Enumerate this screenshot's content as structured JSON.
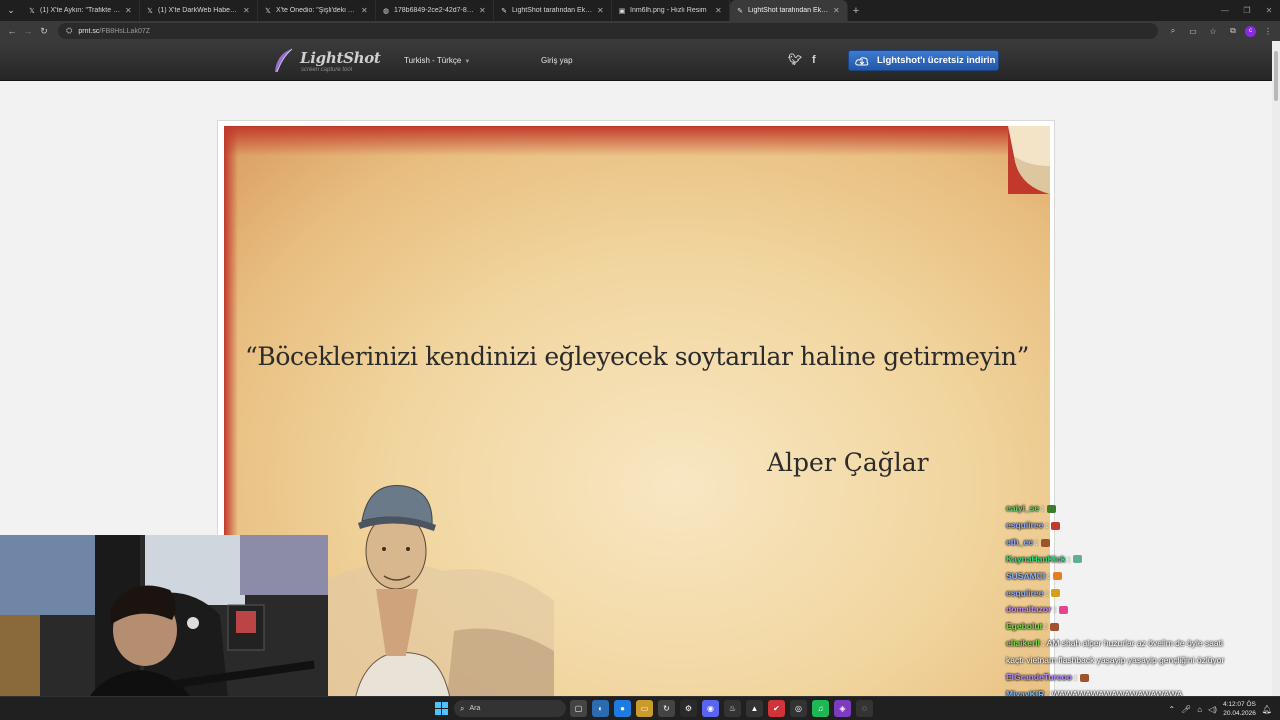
{
  "browser": {
    "tabs": [
      {
        "title": "(1) X'te Aykırı: \"Trafikte 2 meden",
        "icon": "x-logo-icon",
        "active": false
      },
      {
        "title": "(1) X'te DarkWeb Haber: \"Bir gü",
        "icon": "x-logo-icon",
        "active": false
      },
      {
        "title": "X'te Onedio: \"Şişli'deki bir ilkok",
        "icon": "x-logo-icon",
        "active": false
      },
      {
        "title": "178b6849-2ce2-42d7-8750-26",
        "icon": "globe-icon",
        "active": false
      },
      {
        "title": "LightShot tarafından Ekran Gör",
        "icon": "feather-icon",
        "active": false
      },
      {
        "title": "Inm6lh.png - Hızlı Resim",
        "icon": "image-icon",
        "active": false
      },
      {
        "title": "LightShot tarafından Ekran Gör",
        "icon": "feather-icon",
        "active": true
      }
    ],
    "url_host": "prnt.sc",
    "url_path": "/FB8HsLLak07Z"
  },
  "lightshot": {
    "brand": "LightShot",
    "tagline": "screen capture tool",
    "language": "Turkish - Türkçe",
    "login": "Giriş yap",
    "download": "Lightshot'ı ücretsiz indirin"
  },
  "screenshot": {
    "quote": "“Böceklerinizi kendinizi eğleyecek soytarılar haline getirmeyin”",
    "author": "Alper Çağlar"
  },
  "chat": [
    {
      "user": "eaiyi_se",
      "color": "#6bd36b",
      "msg": ":",
      "emote": "#3a7d2a"
    },
    {
      "user": "esquiiree",
      "color": "#8aa8ff",
      "msg": ":",
      "emote": "#c0392b"
    },
    {
      "user": "eth_ee",
      "color": "#8aa8ff",
      "msg": ":",
      "emote": "#a0522d"
    },
    {
      "user": "KaynaHanKick",
      "color": "#33e07a",
      "msg": ":",
      "emote": "#6a9"
    },
    {
      "user": "SUSAMCI",
      "color": "#8fb4ff",
      "msg": ":",
      "emote": "#e67e22"
    },
    {
      "user": "esquiiree",
      "color": "#8aa8ff",
      "msg": ":",
      "emote": "#d4a017"
    },
    {
      "user": "domaltazor",
      "color": "#c98bff",
      "msg": ":",
      "emote": "#e84393"
    },
    {
      "user": "Egebolut",
      "color": "#7ddc4a",
      "msg": ":",
      "emote": "#a0522d"
    },
    {
      "user": "eliaikerll",
      "color": "#7ddc4a",
      "msg": ": AM shah alper huzurlar az övelim de öyle saati",
      "emote": ""
    },
    {
      "user": "",
      "color": "#fff",
      "msg": "kaçtı vietnam flashback yaşayip yaşayip gençliğini özlüyor",
      "emote": ""
    },
    {
      "user": "ElGrandeTurcoo",
      "color": "#b48cff",
      "msg": ":",
      "emote": "#a0522d"
    },
    {
      "user": "MiyavKIR",
      "color": "#7ab8ff",
      "msg": ": WAWAWAWAWAWAWAWAWAWA",
      "emote": ""
    },
    {
      "user": "esquiiree",
      "color": "#8aa8ff",
      "msg": ":",
      "emote": "#7a6"
    }
  ],
  "taskbar": {
    "search_label": "Ara",
    "time": "4:12:07 ÖS",
    "date": "20.04.2026"
  },
  "colors": {
    "download_button": "#2f6bc1",
    "header_bg": "#2f2f2f",
    "page_bg": "#f2f2f2"
  }
}
